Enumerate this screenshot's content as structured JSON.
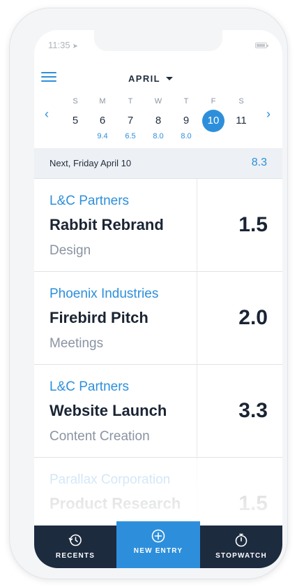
{
  "status": {
    "time": "11:35",
    "location_glyph": "➤"
  },
  "header": {
    "month": "APRIL",
    "prev_glyph": "‹",
    "next_glyph": "›"
  },
  "week": [
    {
      "name": "S",
      "num": "5",
      "hours": ""
    },
    {
      "name": "M",
      "num": "6",
      "hours": "9.4"
    },
    {
      "name": "T",
      "num": "7",
      "hours": "6.5"
    },
    {
      "name": "W",
      "num": "8",
      "hours": "8.0"
    },
    {
      "name": "T",
      "num": "9",
      "hours": "8.0"
    },
    {
      "name": "F",
      "num": "10",
      "hours": "",
      "selected": true
    },
    {
      "name": "S",
      "num": "11",
      "hours": ""
    }
  ],
  "next_bar": {
    "label": "Next, Friday April 10",
    "total": "8.3"
  },
  "entries": [
    {
      "client": "L&C Partners",
      "project": "Rabbit Rebrand",
      "task": "Design",
      "hours": "1.5"
    },
    {
      "client": "Phoenix Industries",
      "project": "Firebird Pitch",
      "task": "Meetings",
      "hours": "2.0"
    },
    {
      "client": "L&C Partners",
      "project": "Website Launch",
      "task": "Content Creation",
      "hours": "3.3"
    },
    {
      "client": "Parallax Corporation",
      "project": "Product Research",
      "task": "",
      "hours": "1.5"
    }
  ],
  "tabs": {
    "recents": "RECENTS",
    "new_entry": "NEW ENTRY",
    "stopwatch": "STOPWATCH"
  },
  "colors": {
    "accent": "#2d8fdb",
    "navy": "#1d2b3f",
    "text": "#1a2433",
    "muted": "#8a94a3"
  },
  "icons": [
    "menu-icon",
    "chevron-left-icon",
    "chevron-right-icon",
    "caret-down-icon",
    "history-icon",
    "plus-circle-icon",
    "stopwatch-icon",
    "battery-icon"
  ]
}
